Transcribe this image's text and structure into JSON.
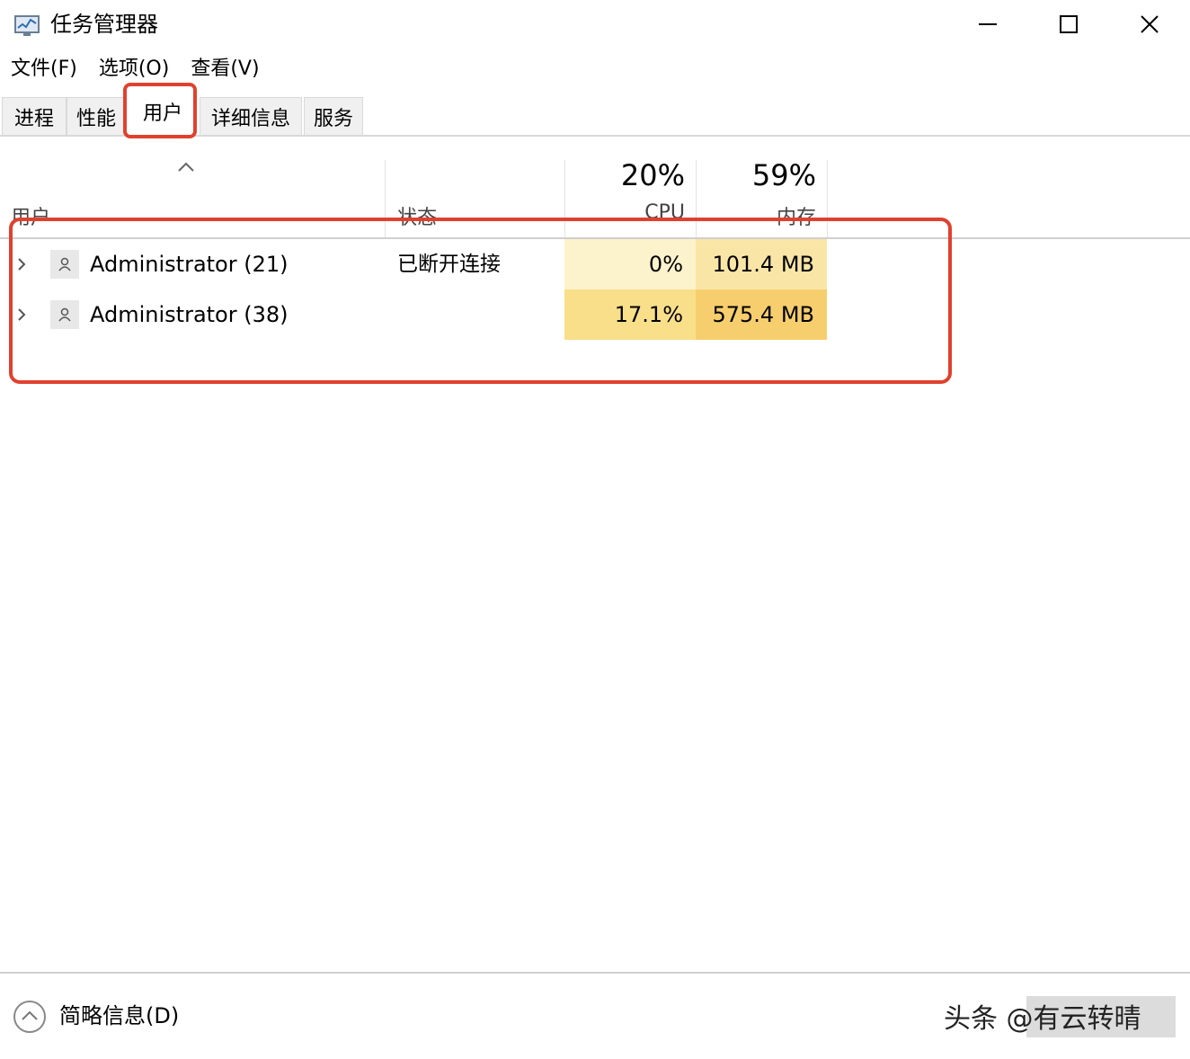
{
  "window": {
    "title": "任务管理器",
    "icon": "task-manager-icon",
    "controls": [
      "minimize-icon",
      "maximize-icon",
      "close-icon"
    ]
  },
  "menu": {
    "items": [
      {
        "label": "文件(F)"
      },
      {
        "label": "选项(O)"
      },
      {
        "label": "查看(V)"
      }
    ]
  },
  "tabs": [
    {
      "label": "进程"
    },
    {
      "label": "性能"
    },
    {
      "label": "用户",
      "active": true
    },
    {
      "label": "详细信息"
    },
    {
      "label": "服务"
    }
  ],
  "columns": {
    "user": {
      "label": "用户"
    },
    "status": {
      "label": "状态"
    },
    "cpu": {
      "label": "CPU",
      "total": "20%"
    },
    "memory": {
      "label": "内存",
      "total": "59%"
    }
  },
  "rows": [
    {
      "name": "Administrator (21)",
      "status": "已断开连接",
      "cpu": "0%",
      "memory": "101.4 MB"
    },
    {
      "name": "Administrator (38)",
      "status": "",
      "cpu": "17.1%",
      "memory": "575.4 MB"
    }
  ],
  "colors": {
    "highlight": "#e0412f",
    "heat_light": "#fcf2cc",
    "heat_medium": "#f9e6a6",
    "heat_strong": "#f9df8a",
    "heat_stronger": "#f6ce6d"
  },
  "footer": {
    "toggle_label": "简略信息(D)",
    "toggle_icon": "chevron-up-circle-icon"
  },
  "watermark": "头条 @有云转晴"
}
